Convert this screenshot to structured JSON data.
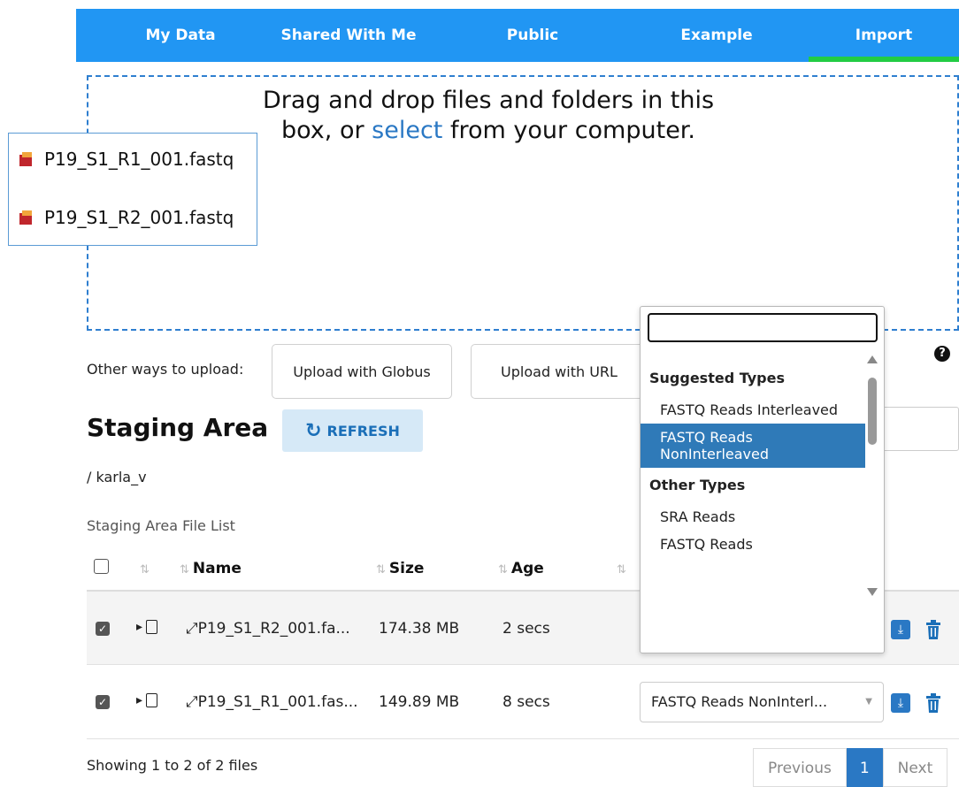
{
  "nav": {
    "tabs": [
      {
        "label": "My Data"
      },
      {
        "label": "Shared With Me"
      },
      {
        "label": "Public"
      },
      {
        "label": "Example"
      },
      {
        "label": "Import",
        "active": true
      }
    ],
    "active_indicator_color": "#22cc44",
    "background_color": "#2196f3"
  },
  "drag_preview": {
    "files": [
      "P19_S1_R1_001.fastq",
      "P19_S1_R2_001.fastq"
    ],
    "icon": "file-stack-icon"
  },
  "dropzone": {
    "text_before": "Drag and drop files and folders in this box, or ",
    "link": "select",
    "text_after": " from your computer."
  },
  "upload": {
    "label": "Other ways to upload:",
    "globus": "Upload with Globus",
    "url": "Upload with URL",
    "help_icon": "question-circle-icon"
  },
  "staging": {
    "title": "Staging Area",
    "refresh": "REFRESH",
    "path": "/ karla_v",
    "list_label": "Staging Area File List"
  },
  "table": {
    "headers": {
      "name": "Name",
      "size": "Size",
      "age": "Age"
    },
    "rows": [
      {
        "checked": true,
        "name": "P19_S1_R2_001.fa...",
        "size": "174.38 MB",
        "age": "2 secs",
        "type": "FASTQ Reads NonInterl..."
      },
      {
        "checked": true,
        "name": "P19_S1_R1_001.fas...",
        "size": "149.89 MB",
        "age": "8 secs",
        "type": "FASTQ Reads NonInterl..."
      }
    ]
  },
  "footer": {
    "showing": "Showing 1 to 2 of 2 files",
    "prev": "Previous",
    "page": "1",
    "next": "Next"
  },
  "dropdown": {
    "search_value": "",
    "groups": [
      {
        "label": "Suggested Types",
        "options": [
          {
            "label": "FASTQ Reads Interleaved",
            "selected": false
          },
          {
            "label": "FASTQ Reads NonInterleaved",
            "selected": true
          }
        ]
      },
      {
        "label": "Other Types",
        "options": [
          {
            "label": "SRA Reads",
            "selected": false
          },
          {
            "label": "FASTQ Reads",
            "selected": false
          }
        ]
      }
    ]
  }
}
